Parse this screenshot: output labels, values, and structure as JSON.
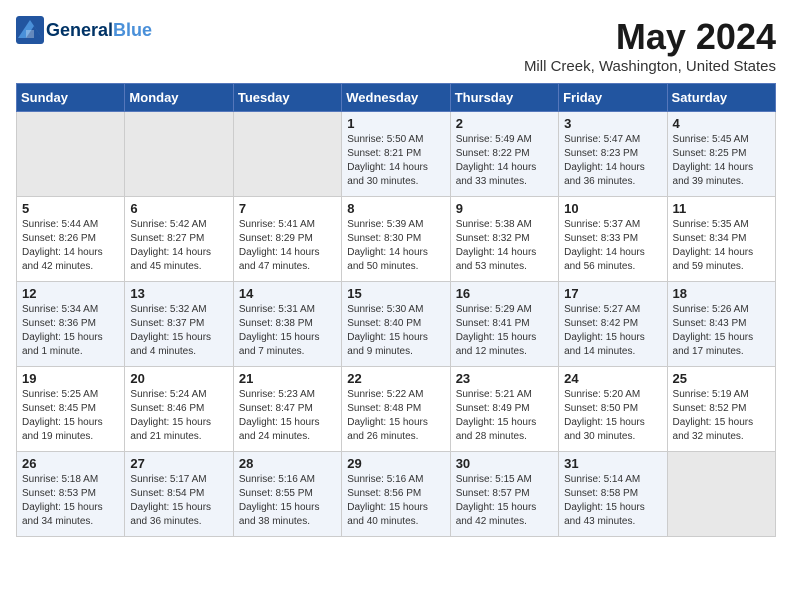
{
  "logo": {
    "general": "General",
    "blue": "Blue"
  },
  "title": "May 2024",
  "location": "Mill Creek, Washington, United States",
  "days_of_week": [
    "Sunday",
    "Monday",
    "Tuesday",
    "Wednesday",
    "Thursday",
    "Friday",
    "Saturday"
  ],
  "weeks": [
    [
      {
        "day": "",
        "content": ""
      },
      {
        "day": "",
        "content": ""
      },
      {
        "day": "",
        "content": ""
      },
      {
        "day": "1",
        "content": "Sunrise: 5:50 AM\nSunset: 8:21 PM\nDaylight: 14 hours\nand 30 minutes."
      },
      {
        "day": "2",
        "content": "Sunrise: 5:49 AM\nSunset: 8:22 PM\nDaylight: 14 hours\nand 33 minutes."
      },
      {
        "day": "3",
        "content": "Sunrise: 5:47 AM\nSunset: 8:23 PM\nDaylight: 14 hours\nand 36 minutes."
      },
      {
        "day": "4",
        "content": "Sunrise: 5:45 AM\nSunset: 8:25 PM\nDaylight: 14 hours\nand 39 minutes."
      }
    ],
    [
      {
        "day": "5",
        "content": "Sunrise: 5:44 AM\nSunset: 8:26 PM\nDaylight: 14 hours\nand 42 minutes."
      },
      {
        "day": "6",
        "content": "Sunrise: 5:42 AM\nSunset: 8:27 PM\nDaylight: 14 hours\nand 45 minutes."
      },
      {
        "day": "7",
        "content": "Sunrise: 5:41 AM\nSunset: 8:29 PM\nDaylight: 14 hours\nand 47 minutes."
      },
      {
        "day": "8",
        "content": "Sunrise: 5:39 AM\nSunset: 8:30 PM\nDaylight: 14 hours\nand 50 minutes."
      },
      {
        "day": "9",
        "content": "Sunrise: 5:38 AM\nSunset: 8:32 PM\nDaylight: 14 hours\nand 53 minutes."
      },
      {
        "day": "10",
        "content": "Sunrise: 5:37 AM\nSunset: 8:33 PM\nDaylight: 14 hours\nand 56 minutes."
      },
      {
        "day": "11",
        "content": "Sunrise: 5:35 AM\nSunset: 8:34 PM\nDaylight: 14 hours\nand 59 minutes."
      }
    ],
    [
      {
        "day": "12",
        "content": "Sunrise: 5:34 AM\nSunset: 8:36 PM\nDaylight: 15 hours\nand 1 minute."
      },
      {
        "day": "13",
        "content": "Sunrise: 5:32 AM\nSunset: 8:37 PM\nDaylight: 15 hours\nand 4 minutes."
      },
      {
        "day": "14",
        "content": "Sunrise: 5:31 AM\nSunset: 8:38 PM\nDaylight: 15 hours\nand 7 minutes."
      },
      {
        "day": "15",
        "content": "Sunrise: 5:30 AM\nSunset: 8:40 PM\nDaylight: 15 hours\nand 9 minutes."
      },
      {
        "day": "16",
        "content": "Sunrise: 5:29 AM\nSunset: 8:41 PM\nDaylight: 15 hours\nand 12 minutes."
      },
      {
        "day": "17",
        "content": "Sunrise: 5:27 AM\nSunset: 8:42 PM\nDaylight: 15 hours\nand 14 minutes."
      },
      {
        "day": "18",
        "content": "Sunrise: 5:26 AM\nSunset: 8:43 PM\nDaylight: 15 hours\nand 17 minutes."
      }
    ],
    [
      {
        "day": "19",
        "content": "Sunrise: 5:25 AM\nSunset: 8:45 PM\nDaylight: 15 hours\nand 19 minutes."
      },
      {
        "day": "20",
        "content": "Sunrise: 5:24 AM\nSunset: 8:46 PM\nDaylight: 15 hours\nand 21 minutes."
      },
      {
        "day": "21",
        "content": "Sunrise: 5:23 AM\nSunset: 8:47 PM\nDaylight: 15 hours\nand 24 minutes."
      },
      {
        "day": "22",
        "content": "Sunrise: 5:22 AM\nSunset: 8:48 PM\nDaylight: 15 hours\nand 26 minutes."
      },
      {
        "day": "23",
        "content": "Sunrise: 5:21 AM\nSunset: 8:49 PM\nDaylight: 15 hours\nand 28 minutes."
      },
      {
        "day": "24",
        "content": "Sunrise: 5:20 AM\nSunset: 8:50 PM\nDaylight: 15 hours\nand 30 minutes."
      },
      {
        "day": "25",
        "content": "Sunrise: 5:19 AM\nSunset: 8:52 PM\nDaylight: 15 hours\nand 32 minutes."
      }
    ],
    [
      {
        "day": "26",
        "content": "Sunrise: 5:18 AM\nSunset: 8:53 PM\nDaylight: 15 hours\nand 34 minutes."
      },
      {
        "day": "27",
        "content": "Sunrise: 5:17 AM\nSunset: 8:54 PM\nDaylight: 15 hours\nand 36 minutes."
      },
      {
        "day": "28",
        "content": "Sunrise: 5:16 AM\nSunset: 8:55 PM\nDaylight: 15 hours\nand 38 minutes."
      },
      {
        "day": "29",
        "content": "Sunrise: 5:16 AM\nSunset: 8:56 PM\nDaylight: 15 hours\nand 40 minutes."
      },
      {
        "day": "30",
        "content": "Sunrise: 5:15 AM\nSunset: 8:57 PM\nDaylight: 15 hours\nand 42 minutes."
      },
      {
        "day": "31",
        "content": "Sunrise: 5:14 AM\nSunset: 8:58 PM\nDaylight: 15 hours\nand 43 minutes."
      },
      {
        "day": "",
        "content": ""
      }
    ]
  ]
}
